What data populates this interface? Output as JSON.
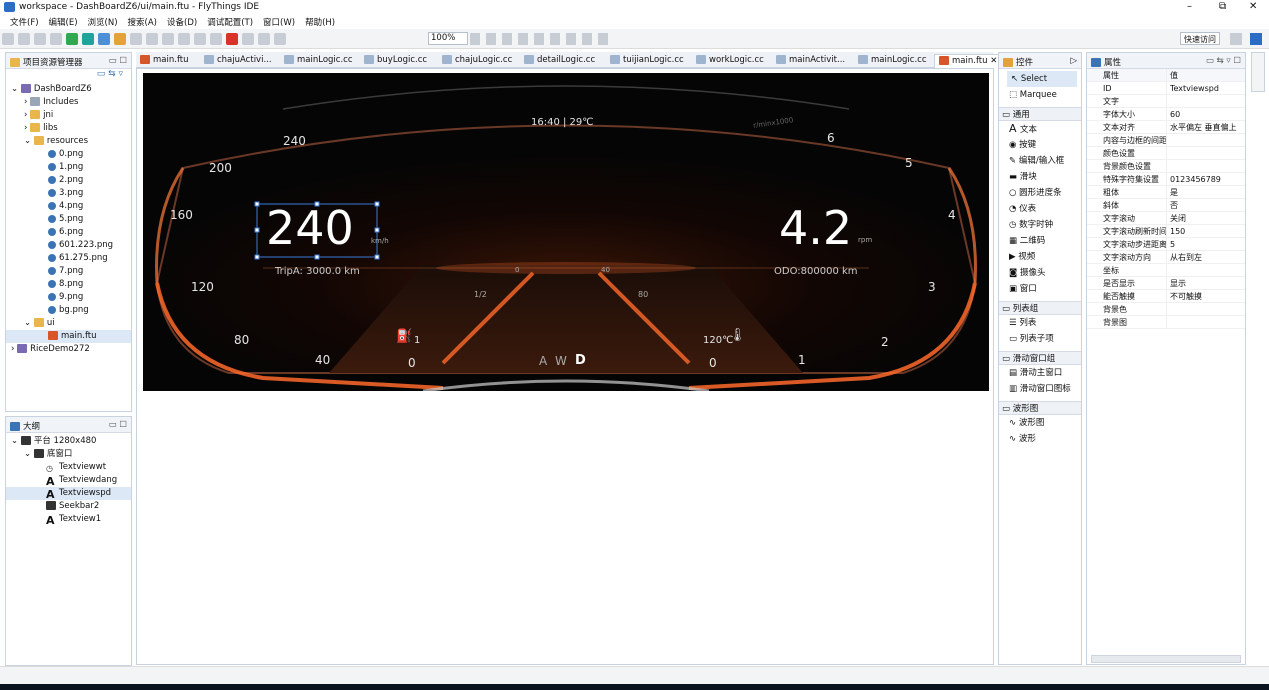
{
  "window": {
    "title": "workspace - DashBoardZ6/ui/main.ftu - FlyThings IDE",
    "controls": [
      "–",
      "⧉",
      "✕"
    ]
  },
  "menu": [
    "文件(F)",
    "编辑(E)",
    "浏览(N)",
    "搜索(A)",
    "设备(D)",
    "调试配置(T)",
    "窗口(W)",
    "帮助(H)"
  ],
  "toolbar": {
    "zoom": "100%",
    "quick_access": "快速访问"
  },
  "project_explorer": {
    "title": "项目资源管理器",
    "items": [
      {
        "label": "DashBoardZ6"
      },
      {
        "label": "Includes"
      },
      {
        "label": "jni"
      },
      {
        "label": "libs"
      },
      {
        "label": "resources"
      },
      {
        "label": "0.png"
      },
      {
        "label": "1.png"
      },
      {
        "label": "2.png"
      },
      {
        "label": "3.png"
      },
      {
        "label": "4.png"
      },
      {
        "label": "5.png"
      },
      {
        "label": "6.png"
      },
      {
        "label": "601.223.png"
      },
      {
        "label": "61.275.png"
      },
      {
        "label": "7.png"
      },
      {
        "label": "8.png"
      },
      {
        "label": "9.png"
      },
      {
        "label": "bg.png"
      },
      {
        "label": "ui"
      },
      {
        "label": "main.ftu"
      },
      {
        "label": "RiceDemo272"
      }
    ]
  },
  "outline": {
    "title": "大纲",
    "items": [
      {
        "label": "平台 1280x480"
      },
      {
        "label": "底窗口"
      },
      {
        "label": "Textviewwt"
      },
      {
        "label": "Textviewdang"
      },
      {
        "label": "Textviewspd"
      },
      {
        "label": "Seekbar2"
      },
      {
        "label": "Textview1"
      }
    ]
  },
  "editor_tabs": [
    {
      "label": "main.ftu"
    },
    {
      "label": "chajuActivi..."
    },
    {
      "label": "mainLogic.cc"
    },
    {
      "label": "buyLogic.cc"
    },
    {
      "label": "chajuLogic.cc"
    },
    {
      "label": "detailLogic.cc"
    },
    {
      "label": "tuijianLogic.cc"
    },
    {
      "label": "workLogic.cc"
    },
    {
      "label": "mainActivit..."
    },
    {
      "label": "mainLogic.cc"
    },
    {
      "label": "main.ftu"
    },
    {
      "label": "»₁"
    }
  ],
  "dashboard": {
    "time_temp": "16:40  |  29℃",
    "speed": "240",
    "speed_unit": "km/h",
    "rpm": "4.2",
    "rpm_unit": "rpm",
    "rpm_scale_label": "r/minx1000",
    "trip": "TripA: 3000.0 km",
    "odo": "ODO:800000 km",
    "drive": "A W",
    "drive_active": "D",
    "speed_ticks": [
      "240",
      "200",
      "160",
      "120",
      "80",
      "40",
      "0"
    ],
    "rpm_ticks": [
      "6",
      "5",
      "4",
      "3",
      "2",
      "1",
      "0"
    ],
    "fuel_marks": [
      "1",
      "1/2"
    ],
    "temp_marks": [
      "120℃",
      "80"
    ],
    "center_marks": [
      "0",
      "40"
    ]
  },
  "palette": {
    "title": "控件",
    "top_items": [
      "Select",
      "Marquee"
    ],
    "groups": [
      {
        "title": "通用",
        "items": [
          "文本",
          "按键",
          "编辑/输入框",
          "滑块",
          "圆形进度条",
          "仪表",
          "数字时钟",
          "二维码",
          "视频",
          "摄像头",
          "窗口"
        ]
      },
      {
        "title": "列表组",
        "items": [
          "列表",
          "列表子项"
        ]
      },
      {
        "title": "滑动窗口组",
        "items": [
          "滑动主窗口",
          "滑动窗口图标"
        ]
      },
      {
        "title": "波形图",
        "items": [
          "波形图",
          "波形"
        ]
      }
    ]
  },
  "properties": {
    "title": "属性",
    "col_name": "属性",
    "col_value": "值",
    "rows": [
      {
        "k": "ID",
        "v": "Textviewspd"
      },
      {
        "k": "文字",
        "v": ""
      },
      {
        "k": "字体大小",
        "v": "60"
      },
      {
        "k": "文本对齐",
        "v": "水平偏左 垂直偏上"
      },
      {
        "k": "内容与边框的间距",
        "v": ""
      },
      {
        "k": "颜色设置",
        "v": ""
      },
      {
        "k": "背景颜色设置",
        "v": ""
      },
      {
        "k": "特殊字符集设置",
        "v": "0123456789"
      },
      {
        "k": "粗体",
        "v": "是"
      },
      {
        "k": "斜体",
        "v": "否"
      },
      {
        "k": "文字滚动",
        "v": "关闭"
      },
      {
        "k": "文字滚动刷新时间",
        "v": "150"
      },
      {
        "k": "文字滚动步进距离",
        "v": "5"
      },
      {
        "k": "文字滚动方向",
        "v": "从右到左"
      },
      {
        "k": "坐标",
        "v": ""
      },
      {
        "k": "是否显示",
        "v": "显示"
      },
      {
        "k": "能否触摸",
        "v": "不可触摸"
      },
      {
        "k": "背景色",
        "v": ""
      },
      {
        "k": "背景图",
        "v": ""
      }
    ]
  },
  "colors": {
    "accent": "#ff6a2a",
    "selection": "#3a7bd5",
    "dash_bg": "#050505"
  }
}
